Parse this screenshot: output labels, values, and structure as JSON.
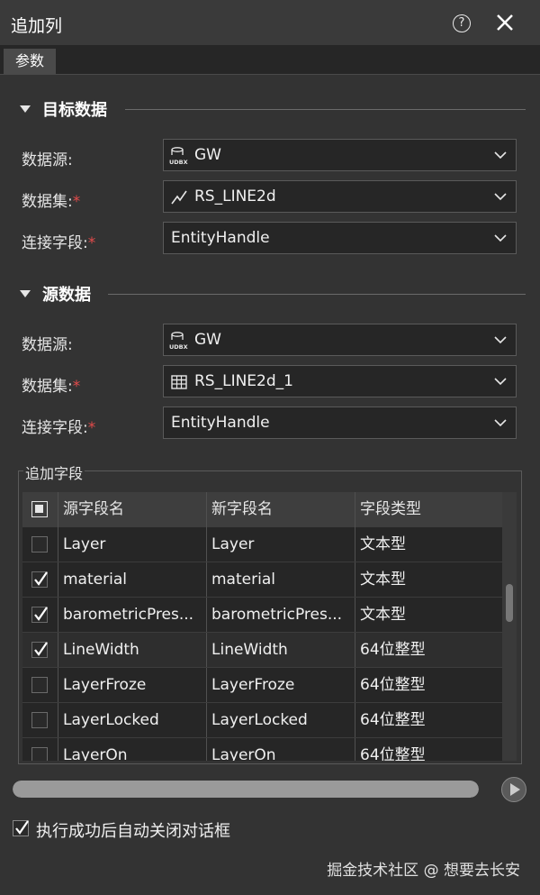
{
  "window": {
    "title": "追加列",
    "help_glyph": "?"
  },
  "tabs": [
    {
      "label": "参数"
    }
  ],
  "target": {
    "section_title": "目标数据",
    "datasource_label": "数据源:",
    "datasource_value": "GW",
    "datasource_icon": "udbx-datasource-icon",
    "dataset_label": "数据集:",
    "dataset_value": "RS_LINE2d",
    "dataset_icon": "line-dataset-icon",
    "link_field_label": "连接字段:",
    "link_field_value": "EntityHandle"
  },
  "source": {
    "section_title": "源数据",
    "datasource_label": "数据源:",
    "datasource_value": "GW",
    "datasource_icon": "udbx-datasource-icon",
    "dataset_label": "数据集:",
    "dataset_value": "RS_LINE2d_1",
    "dataset_icon": "table-dataset-icon",
    "link_field_label": "连接字段:",
    "link_field_value": "EntityHandle"
  },
  "required_mark": "*",
  "append_fields": {
    "group_label": "追加字段",
    "columns": [
      "源字段名",
      "新字段名",
      "字段类型"
    ],
    "rows": [
      {
        "checked": false,
        "source": "Layer",
        "new": "Layer",
        "type": "文本型"
      },
      {
        "checked": true,
        "source": "material",
        "new": "material",
        "type": "文本型"
      },
      {
        "checked": true,
        "source": "barometricPres...",
        "new": "barometricPres...",
        "type": "文本型"
      },
      {
        "checked": true,
        "source": "LineWidth",
        "new": "LineWidth",
        "type": "64位整型"
      },
      {
        "checked": false,
        "source": "LayerFroze",
        "new": "LayerFroze",
        "type": "64位整型"
      },
      {
        "checked": false,
        "source": "LayerLocked",
        "new": "LayerLocked",
        "type": "64位整型"
      },
      {
        "checked": false,
        "source": "LayerOn",
        "new": "LayerOn",
        "type": "64位整型"
      }
    ]
  },
  "progress": {
    "value": 1.0
  },
  "auto_close": {
    "label": "执行成功后自动关闭对话框",
    "checked": true
  },
  "watermark": "掘金技术社区 @ 想要去长安",
  "colors": {
    "background": "#333333",
    "title_bar": "#3a3a3a",
    "required": "#e14b4b",
    "field_bg": "#262626"
  }
}
